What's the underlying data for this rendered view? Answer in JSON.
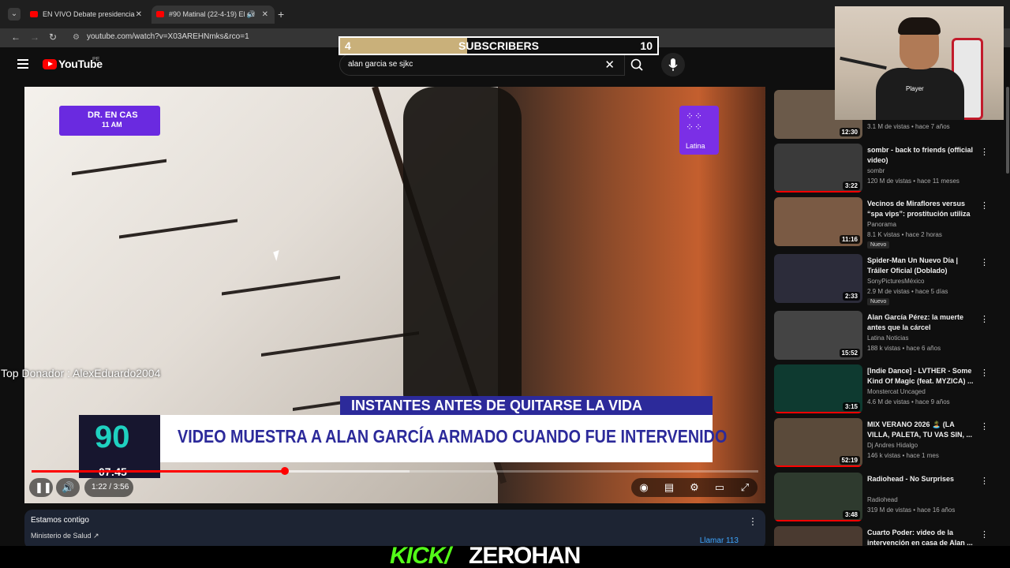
{
  "browser": {
    "tabs": [
      {
        "title": "EN VIVO Debate presidencia",
        "active": false
      },
      {
        "title": "#90 Matinal (22-4-19) El ex",
        "active": true
      }
    ],
    "url": "youtube.com/watch?v=X03AREHNmks&rco=1"
  },
  "youtube": {
    "logo_text": "YouTube",
    "country": "PE",
    "search_value": "alan garcia se sjkc"
  },
  "subscriber_goal": {
    "current": "4",
    "label": "SUBSCRIBERS",
    "target": "10",
    "progress_fraction": 0.4
  },
  "video": {
    "badge_top_left_line1": "DR. EN CAS",
    "badge_top_left_line2": "11 AM",
    "badge_top_right": "Latina",
    "lower_third_top": "INSTANTES ANTES DE QUITARSE LA VIDA",
    "lower_third_main": "VIDEO MUESTRA A ALAN GARCÍA ARMADO CUANDO FUE INTERVENIDO",
    "program_logo": "90",
    "program_clock": "07:45",
    "time_display": "1:22 / 3:56",
    "played_fraction": 0.348,
    "buffered_fraction": 0.52
  },
  "info_box": {
    "title": "Estamos contigo",
    "subtitle": "Ministerio de Salud ↗",
    "call_label": "Llamar 113"
  },
  "recommendations": [
    {
      "title": "",
      "channel": "",
      "meta": "3.1 M de vistas • hace 7 años",
      "duration": "12:30",
      "new": false,
      "thumb_color": "#6b5a4a"
    },
    {
      "title": "sombr - back to friends (official video)",
      "channel": "sombr",
      "meta": "120 M de vistas • hace 11 meses",
      "duration": "3:22",
      "new": false,
      "thumb_color": "#3a3a3a"
    },
    {
      "title": "Vecinos de Miraflores versus “spa vips”: prostitución utiliza ...",
      "channel": "Panorama",
      "meta": "8.1 K vistas • hace 2 horas",
      "duration": "11:16",
      "new": true,
      "thumb_color": "#7a5a44"
    },
    {
      "title": "Spider-Man Un Nuevo Día | Tráiler Oficial (Doblado)",
      "channel": "SonyPicturesMéxico",
      "meta": "2.9 M de vistas • hace 5 días",
      "duration": "2:33",
      "new": true,
      "thumb_color": "#2c2c3a"
    },
    {
      "title": "Alan García Pérez: la muerte antes que la cárcel",
      "channel": "Latina Noticias",
      "meta": "188 k vistas • hace 6 años",
      "duration": "15:52",
      "new": false,
      "thumb_color": "#444444"
    },
    {
      "title": "[Indie Dance] - LVTHER - Some Kind Of Magic (feat. MYZICA) ...",
      "channel": "Monstercat Uncaged",
      "meta": "4.6 M de vistas • hace 9 años",
      "duration": "3:15",
      "new": false,
      "thumb_color": "#0e3a30"
    },
    {
      "title": "MIX VERANO 2026 🏝️ (LA VILLA, PALETA, TU VAS SIN, ...",
      "channel": "Dj Andres Hidalgo",
      "meta": "146 k vistas • hace 1 mes",
      "duration": "52:19",
      "new": false,
      "thumb_color": "#5a4a3a"
    },
    {
      "title": "Radiohead - No Surprises",
      "channel": "Radiohead",
      "meta": "319 M de vistas • hace 16 años",
      "duration": "3:48",
      "new": false,
      "thumb_color": "#2e3a2e"
    },
    {
      "title": "Cuarto Poder: video de la intervención en casa de Alan ...",
      "channel": "",
      "meta": "",
      "duration": "",
      "new": false,
      "thumb_color": "#4a3a30"
    }
  ],
  "overlay": {
    "top_donor": "Top Donador : AlexEduardo2004",
    "kick_prefix": "KICK/",
    "kick_name": "ZEROHAN",
    "cam_shirt": "Player"
  },
  "colors": {
    "youtube_red": "#ff0000",
    "kick_green": "#53fc18",
    "latina_purple": "#7b2fe6",
    "goal_fill": "#c9b07a"
  }
}
